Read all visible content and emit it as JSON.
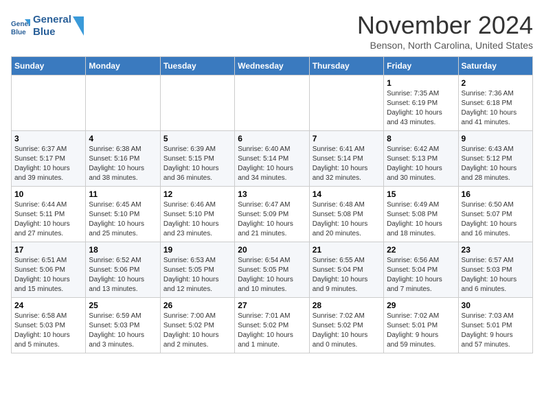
{
  "header": {
    "logo_line1": "General",
    "logo_line2": "Blue",
    "title": "November 2024",
    "subtitle": "Benson, North Carolina, United States"
  },
  "days_of_week": [
    "Sunday",
    "Monday",
    "Tuesday",
    "Wednesday",
    "Thursday",
    "Friday",
    "Saturday"
  ],
  "weeks": [
    {
      "days": [
        {
          "number": "",
          "info": ""
        },
        {
          "number": "",
          "info": ""
        },
        {
          "number": "",
          "info": ""
        },
        {
          "number": "",
          "info": ""
        },
        {
          "number": "",
          "info": ""
        },
        {
          "number": "1",
          "info": "Sunrise: 7:35 AM\nSunset: 6:19 PM\nDaylight: 10 hours\nand 43 minutes."
        },
        {
          "number": "2",
          "info": "Sunrise: 7:36 AM\nSunset: 6:18 PM\nDaylight: 10 hours\nand 41 minutes."
        }
      ]
    },
    {
      "days": [
        {
          "number": "3",
          "info": "Sunrise: 6:37 AM\nSunset: 5:17 PM\nDaylight: 10 hours\nand 39 minutes."
        },
        {
          "number": "4",
          "info": "Sunrise: 6:38 AM\nSunset: 5:16 PM\nDaylight: 10 hours\nand 38 minutes."
        },
        {
          "number": "5",
          "info": "Sunrise: 6:39 AM\nSunset: 5:15 PM\nDaylight: 10 hours\nand 36 minutes."
        },
        {
          "number": "6",
          "info": "Sunrise: 6:40 AM\nSunset: 5:14 PM\nDaylight: 10 hours\nand 34 minutes."
        },
        {
          "number": "7",
          "info": "Sunrise: 6:41 AM\nSunset: 5:14 PM\nDaylight: 10 hours\nand 32 minutes."
        },
        {
          "number": "8",
          "info": "Sunrise: 6:42 AM\nSunset: 5:13 PM\nDaylight: 10 hours\nand 30 minutes."
        },
        {
          "number": "9",
          "info": "Sunrise: 6:43 AM\nSunset: 5:12 PM\nDaylight: 10 hours\nand 28 minutes."
        }
      ]
    },
    {
      "days": [
        {
          "number": "10",
          "info": "Sunrise: 6:44 AM\nSunset: 5:11 PM\nDaylight: 10 hours\nand 27 minutes."
        },
        {
          "number": "11",
          "info": "Sunrise: 6:45 AM\nSunset: 5:10 PM\nDaylight: 10 hours\nand 25 minutes."
        },
        {
          "number": "12",
          "info": "Sunrise: 6:46 AM\nSunset: 5:10 PM\nDaylight: 10 hours\nand 23 minutes."
        },
        {
          "number": "13",
          "info": "Sunrise: 6:47 AM\nSunset: 5:09 PM\nDaylight: 10 hours\nand 21 minutes."
        },
        {
          "number": "14",
          "info": "Sunrise: 6:48 AM\nSunset: 5:08 PM\nDaylight: 10 hours\nand 20 minutes."
        },
        {
          "number": "15",
          "info": "Sunrise: 6:49 AM\nSunset: 5:08 PM\nDaylight: 10 hours\nand 18 minutes."
        },
        {
          "number": "16",
          "info": "Sunrise: 6:50 AM\nSunset: 5:07 PM\nDaylight: 10 hours\nand 16 minutes."
        }
      ]
    },
    {
      "days": [
        {
          "number": "17",
          "info": "Sunrise: 6:51 AM\nSunset: 5:06 PM\nDaylight: 10 hours\nand 15 minutes."
        },
        {
          "number": "18",
          "info": "Sunrise: 6:52 AM\nSunset: 5:06 PM\nDaylight: 10 hours\nand 13 minutes."
        },
        {
          "number": "19",
          "info": "Sunrise: 6:53 AM\nSunset: 5:05 PM\nDaylight: 10 hours\nand 12 minutes."
        },
        {
          "number": "20",
          "info": "Sunrise: 6:54 AM\nSunset: 5:05 PM\nDaylight: 10 hours\nand 10 minutes."
        },
        {
          "number": "21",
          "info": "Sunrise: 6:55 AM\nSunset: 5:04 PM\nDaylight: 10 hours\nand 9 minutes."
        },
        {
          "number": "22",
          "info": "Sunrise: 6:56 AM\nSunset: 5:04 PM\nDaylight: 10 hours\nand 7 minutes."
        },
        {
          "number": "23",
          "info": "Sunrise: 6:57 AM\nSunset: 5:03 PM\nDaylight: 10 hours\nand 6 minutes."
        }
      ]
    },
    {
      "days": [
        {
          "number": "24",
          "info": "Sunrise: 6:58 AM\nSunset: 5:03 PM\nDaylight: 10 hours\nand 5 minutes."
        },
        {
          "number": "25",
          "info": "Sunrise: 6:59 AM\nSunset: 5:03 PM\nDaylight: 10 hours\nand 3 minutes."
        },
        {
          "number": "26",
          "info": "Sunrise: 7:00 AM\nSunset: 5:02 PM\nDaylight: 10 hours\nand 2 minutes."
        },
        {
          "number": "27",
          "info": "Sunrise: 7:01 AM\nSunset: 5:02 PM\nDaylight: 10 hours\nand 1 minute."
        },
        {
          "number": "28",
          "info": "Sunrise: 7:02 AM\nSunset: 5:02 PM\nDaylight: 10 hours\nand 0 minutes."
        },
        {
          "number": "29",
          "info": "Sunrise: 7:02 AM\nSunset: 5:01 PM\nDaylight: 9 hours\nand 59 minutes."
        },
        {
          "number": "30",
          "info": "Sunrise: 7:03 AM\nSunset: 5:01 PM\nDaylight: 9 hours\nand 57 minutes."
        }
      ]
    }
  ]
}
